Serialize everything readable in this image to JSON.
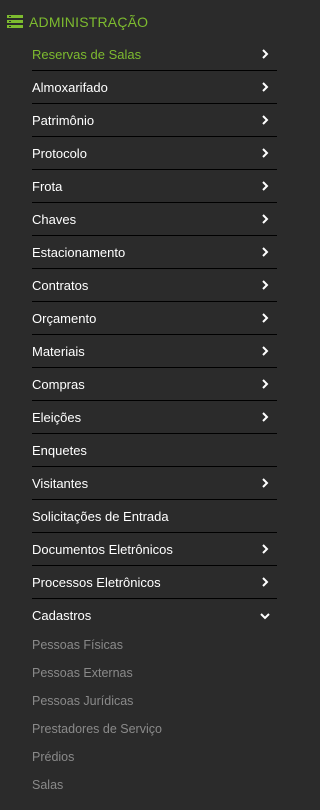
{
  "header": {
    "title": "ADMINISTRAÇÃO",
    "icon": "stacked-list-icon",
    "accent_color": "#7dbb2f"
  },
  "menu": {
    "items": [
      {
        "label": "Reservas de Salas",
        "has_chevron": true,
        "active": true
      },
      {
        "label": "Almoxarifado",
        "has_chevron": true
      },
      {
        "label": "Patrimônio",
        "has_chevron": true
      },
      {
        "label": "Protocolo",
        "has_chevron": true
      },
      {
        "label": "Frota",
        "has_chevron": true
      },
      {
        "label": "Chaves",
        "has_chevron": true
      },
      {
        "label": "Estacionamento",
        "has_chevron": true
      },
      {
        "label": "Contratos",
        "has_chevron": true
      },
      {
        "label": "Orçamento",
        "has_chevron": true
      },
      {
        "label": "Materiais",
        "has_chevron": true
      },
      {
        "label": "Compras",
        "has_chevron": true
      },
      {
        "label": "Eleições",
        "has_chevron": true
      },
      {
        "label": "Enquetes",
        "has_chevron": false
      },
      {
        "label": "Visitantes",
        "has_chevron": true
      },
      {
        "label": "Solicitações de Entrada",
        "has_chevron": false
      },
      {
        "label": "Documentos Eletrônicos",
        "has_chevron": true
      },
      {
        "label": "Processos Eletrônicos",
        "has_chevron": true
      },
      {
        "label": "Cadastros",
        "has_chevron": true,
        "expanded": true
      }
    ]
  },
  "submenu": {
    "items": [
      {
        "label": "Pessoas Físicas"
      },
      {
        "label": "Pessoas Externas"
      },
      {
        "label": "Pessoas Jurídicas"
      },
      {
        "label": "Prestadores de Serviço"
      },
      {
        "label": "Prédios"
      },
      {
        "label": "Salas"
      }
    ]
  }
}
